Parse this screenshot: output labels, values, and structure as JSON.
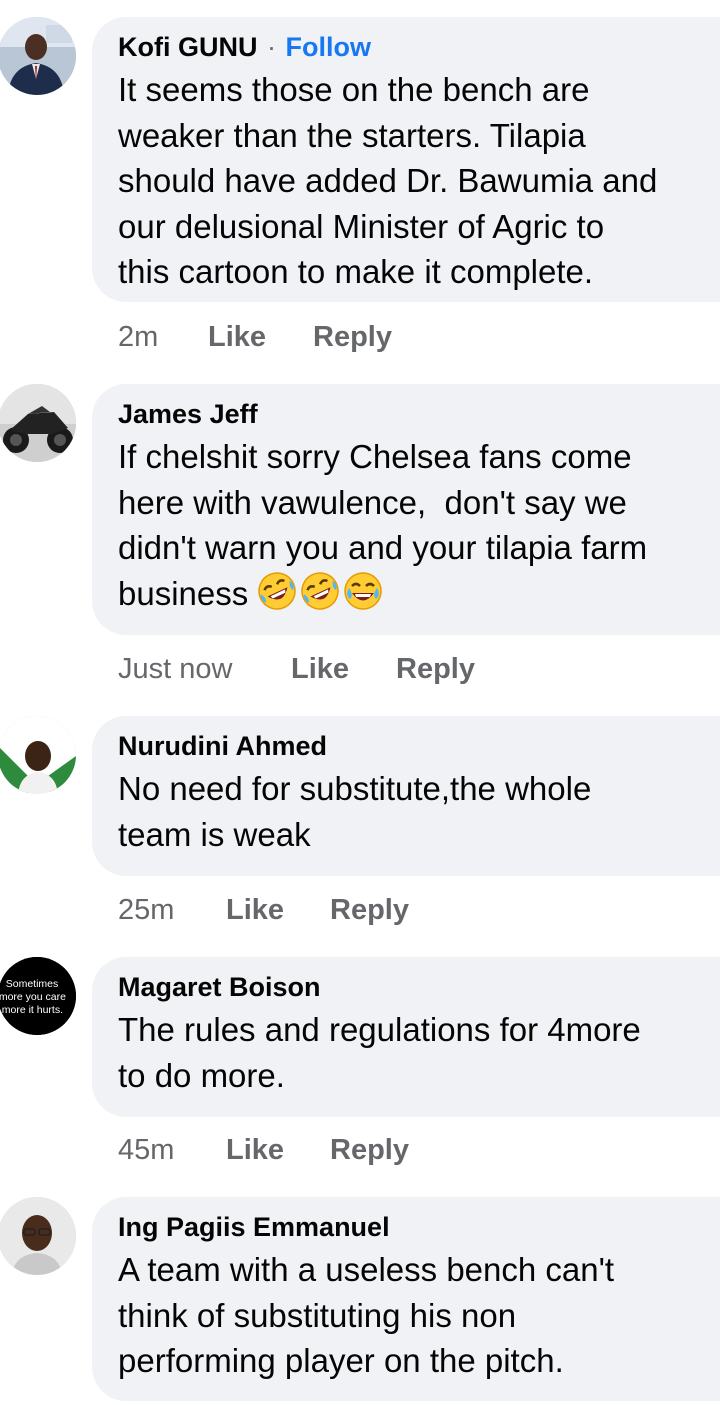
{
  "comments": [
    {
      "author": "Kofi GUNU",
      "separator": "·",
      "follow_label": "Follow",
      "text": "It seems those on the bench are\nweaker than the starters. Tilapia\nshould have added Dr. Bawumia and\nour delusional Minister of Agric to\nthis cartoon to make it complete.",
      "time": "2m",
      "like_label": "Like",
      "reply_label": "Reply"
    },
    {
      "author": "James Jeff",
      "text": "If chelshit sorry Chelsea fans come\nhere with vawulence,  don't say we\ndidn't warn you and your tilapia farm\nbusiness",
      "emojis": [
        "rolling-on-floor-laughing",
        "rolling-on-floor-laughing",
        "tears-of-joy"
      ],
      "time": "Just now",
      "like_label": "Like",
      "reply_label": "Reply"
    },
    {
      "author": "Nurudini Ahmed",
      "text": "No need for substitute,the whole\nteam is weak",
      "time": "25m",
      "like_label": "Like",
      "reply_label": "Reply"
    },
    {
      "author": "Magaret Boison",
      "avatar_text": [
        "Sometimes",
        "e more you care",
        "e more it hurts."
      ],
      "text": "The rules and regulations for 4more\nto do more.",
      "time": "45m",
      "like_label": "Like",
      "reply_label": "Reply"
    },
    {
      "author": "Ing Pagiis Emmanuel",
      "text": "A team with a useless bench can't\nthink of substituting his non\nperforming player on the pitch."
    }
  ],
  "colors": {
    "bubble": "#f0f2f5",
    "follow": "#1877f2",
    "meta": "#65676b"
  }
}
